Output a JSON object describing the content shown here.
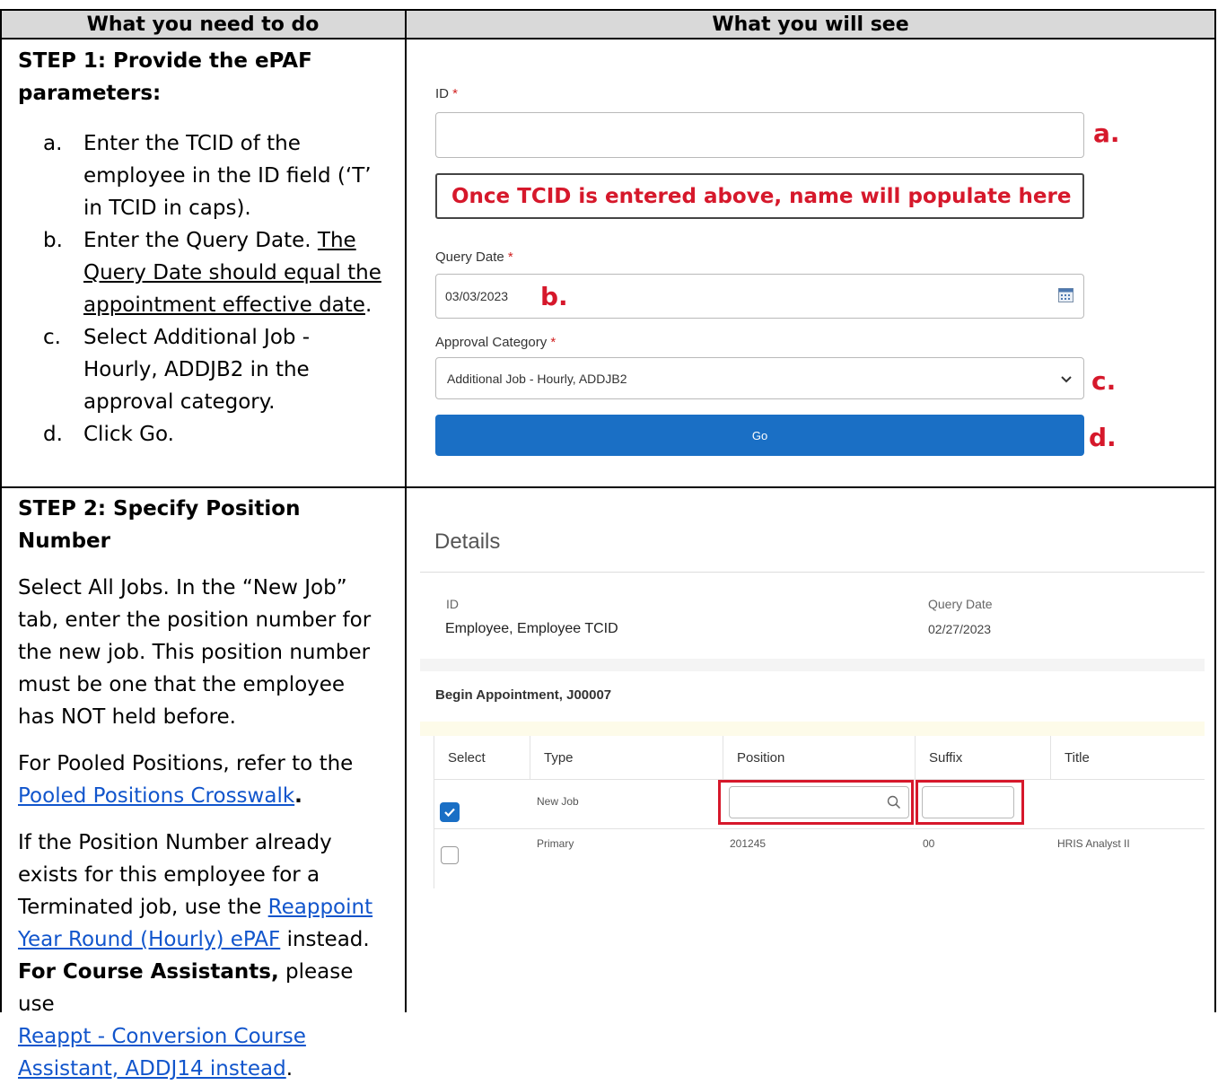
{
  "header": {
    "left": "What you need to do",
    "right": "What you will see"
  },
  "step1": {
    "title_line1": "STEP 1: Provide the ePAF",
    "title_line2": "parameters:",
    "items": [
      {
        "marker": "a.",
        "lines": [
          "Enter the TCID of the",
          "employee in the ID field (‘T’",
          "in TCID in caps)."
        ]
      },
      {
        "marker": "b.",
        "lines": [
          "Enter the Query Date. The",
          "Query Date should equal the",
          "appointment effective date."
        ]
      },
      {
        "marker": "c.",
        "lines": [
          "Select Additional Job -",
          "Hourly, ADDJB2 in the",
          "approval category."
        ]
      },
      {
        "marker": "d.",
        "lines": [
          "Click Go."
        ]
      }
    ],
    "b_plain": "Enter the Query Date. ",
    "b_underline_1": "The",
    "b_underline_2": "Query Date should equal the",
    "b_underline_3": "appointment effective date",
    "b_period": "."
  },
  "form": {
    "id_label": "ID",
    "required_mark": "*",
    "id_value": "",
    "callout": "Once TCID is entered above, name will populate here",
    "query_date_label": "Query Date",
    "query_date_value": "03/03/2023",
    "approval_label": "Approval Category",
    "approval_value": "Additional Job - Hourly, ADDJB2",
    "go_label": "Go",
    "markers": [
      "a.",
      "b.",
      "c.",
      "d."
    ]
  },
  "step2": {
    "title": "STEP 2: Specify Position Number",
    "para1": [
      "Select All Jobs. In the “New Job”",
      "tab, enter the position number for",
      "the new job. This position number",
      "must be one that the employee",
      "has NOT held before."
    ],
    "para2_line1": "For Pooled Positions, refer to the",
    "para2_link": "Pooled Positions Crosswalk",
    "para2_end": ".",
    "para3_lines": [
      "If the Position Number already",
      "exists for this employee for a"
    ],
    "para3_pre": "Terminated job, use the ",
    "para3_link1": "Reappoint",
    "para3_link2": "Year Round (Hourly) ePAF",
    "para3_post": " instead.",
    "para4_bold": "For Course Assistants,",
    "para4_rest": " please use",
    "para4_link1": "Reappt - Conversion Course",
    "para4_link2": "Assistant, ADDJ14 instead",
    "para4_end": "."
  },
  "details": {
    "heading": "Details",
    "id_label": "ID",
    "id_value_1": "Employee,",
    "id_value_2": "Employee TCID",
    "qd_label": "Query Date",
    "qd_value": "02/27/2023",
    "appointment": "Begin Appointment, J00007",
    "columns": [
      "Select",
      "Type",
      "Position",
      "Suffix",
      "Title"
    ],
    "rows": [
      {
        "selected": true,
        "type": "New Job",
        "position": "",
        "suffix": "",
        "title": ""
      },
      {
        "selected": false,
        "type": "Primary",
        "position": "201245",
        "suffix": "00",
        "title": "HRIS Analyst II"
      }
    ]
  },
  "colors": {
    "accent_red": "#d6182b",
    "button_blue": "#1a6fc5",
    "link_blue": "#1155cc"
  }
}
